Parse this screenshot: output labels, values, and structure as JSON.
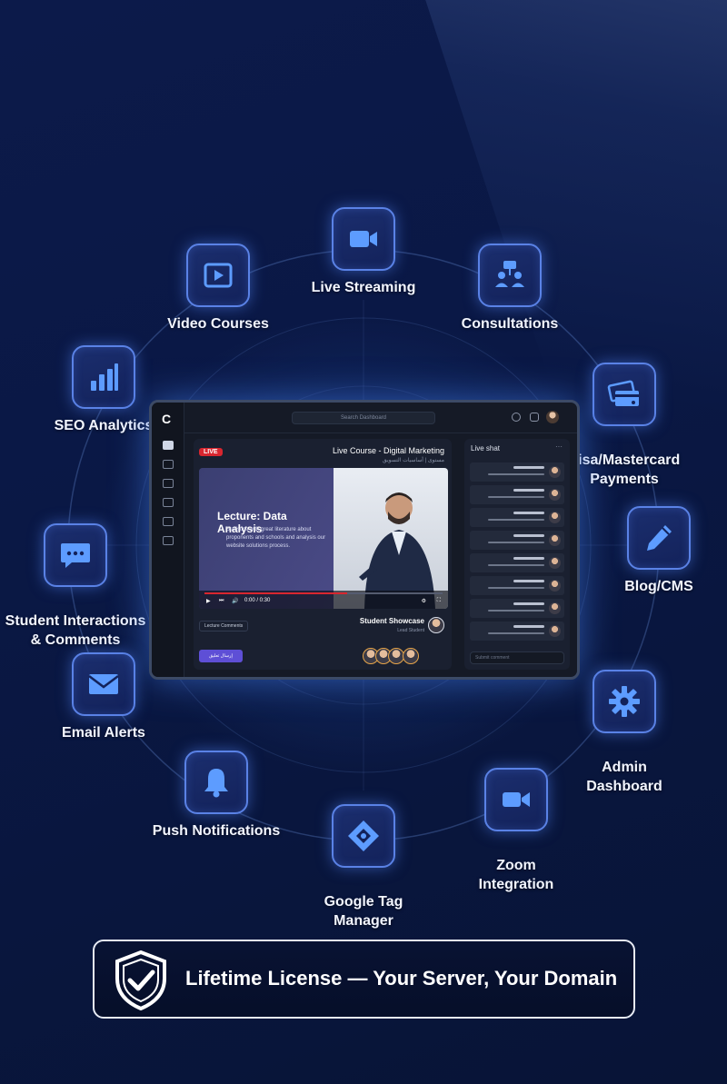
{
  "features": [
    {
      "id": "live-streaming",
      "label": "Live Streaming",
      "icon": "video-camera-icon"
    },
    {
      "id": "video-courses",
      "label": "Video Courses",
      "icon": "play-button-icon"
    },
    {
      "id": "consultations",
      "label": "Consultations",
      "icon": "consultation-icon"
    },
    {
      "id": "seo-analytics",
      "label": "SEO Analytics",
      "icon": "bar-chart-icon"
    },
    {
      "id": "payments",
      "label": "Visa/Mastercard\nPayments",
      "icon": "credit-card-icon"
    },
    {
      "id": "student-interactions",
      "label": "Student Interactions\n& Comments",
      "icon": "chat-bubble-icon"
    },
    {
      "id": "blog-cms",
      "label": "Blog/CMS",
      "icon": "pencil-icon"
    },
    {
      "id": "email-alerts",
      "label": "Email Alerts",
      "icon": "envelope-icon"
    },
    {
      "id": "admin-dashboard",
      "label": "Admin\nDashboard",
      "icon": "gear-icon"
    },
    {
      "id": "push-notifications",
      "label": "Push Notifications",
      "icon": "bell-icon"
    },
    {
      "id": "zoom-integration",
      "label": "Zoom\nIntegration",
      "icon": "zoom-camera-icon"
    },
    {
      "id": "google-tag-manager",
      "label": "Google Tag\nManager",
      "icon": "tag-manager-icon"
    }
  ],
  "dashboard": {
    "logo": "C",
    "search_placeholder": "Search Dashboard",
    "live_badge": "LIVE",
    "course_title": "Live Course - Digital Marketing",
    "course_subtitle": "مستوى | أساسيات التسويق",
    "lecture_title": "Lecture: Data Analysis",
    "lecture_subtitle": "Statistics with great literature about proponents and schools and analysis our website solutions process.",
    "video_time": "0:00 / 0:30",
    "comments_button": "Lecture Comments",
    "student_title": "Student Showcase",
    "student_subtitle": "Lead Student",
    "send_button": "إرسال تعليق",
    "chat_title": "Live shat",
    "chat_input_placeholder": "Submit comment"
  },
  "license": {
    "text": "Lifetime License — Your Server, Your Domain",
    "icon": "shield-check-icon"
  },
  "colors": {
    "background": "#0a1845",
    "icon_border": "#5a82e6",
    "icon_glyph": "#5d9cff",
    "live_red": "#d8262f"
  }
}
